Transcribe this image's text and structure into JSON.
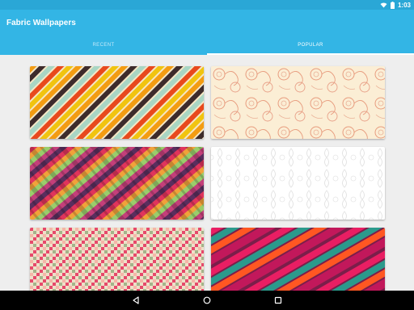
{
  "status_bar": {
    "time": "1:03"
  },
  "app_bar": {
    "title": "Fabric Wallpapers"
  },
  "tabs": [
    {
      "label": "RECENT",
      "active": false
    },
    {
      "label": "POPULAR",
      "active": true
    }
  ],
  "wallpapers": [
    {
      "pattern": "diagonal stripes",
      "colors": [
        "#f39c12",
        "#e8491d",
        "#3d2b2b",
        "#a9d6c4",
        "#f1c40f"
      ]
    },
    {
      "pattern": "floral swirl",
      "colors": [
        "#fbeed5",
        "#e89c7e"
      ]
    },
    {
      "pattern": "checkered diagonal",
      "colors": [
        "#e0345c",
        "#f1a23a",
        "#5a2e5e",
        "#9acd6b",
        "#c43f7a"
      ]
    },
    {
      "pattern": "damask",
      "colors": [
        "#ffffff",
        "#e8e8e8"
      ]
    },
    {
      "pattern": "pixel mosaic",
      "colors": [
        "#e6496b",
        "#f4b6a8",
        "#a4b48a",
        "#eee0c8"
      ]
    },
    {
      "pattern": "diagonal stripes",
      "colors": [
        "#e91e63",
        "#2b9a8c",
        "#ff5722",
        "#7b1e4a"
      ]
    }
  ],
  "nav_bar": {
    "icons": [
      "back-icon",
      "home-icon",
      "recent-apps-icon"
    ]
  }
}
